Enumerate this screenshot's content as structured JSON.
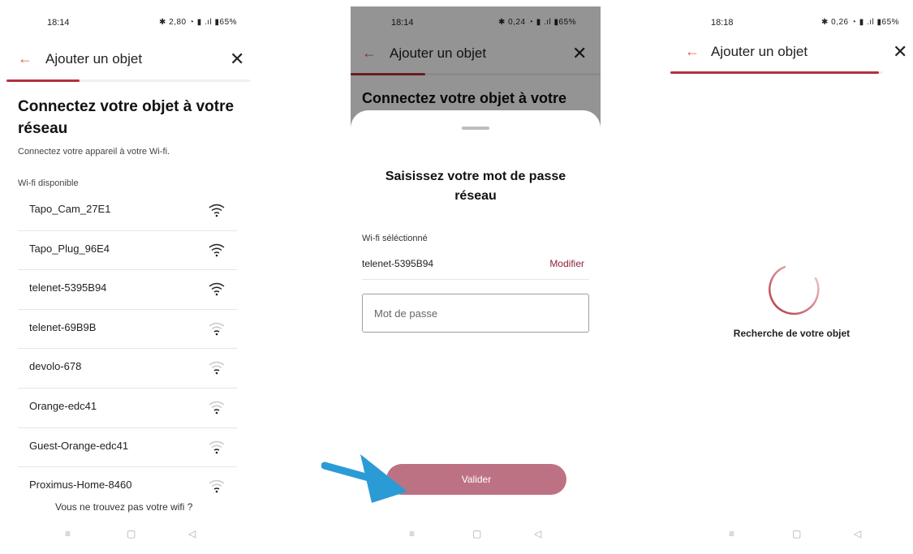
{
  "screen1": {
    "status_time": "18:14",
    "status_indicators": "✱ 2,80 ◔ ▮ .ıl ▮65%",
    "back_icon": "back-arrow-icon",
    "title": "Ajouter un objet",
    "close_icon": "close-icon",
    "progress": 0.3,
    "heading": "Connectez votre objet à votre réseau",
    "subtitle": "Connectez votre appareil à votre Wi-fi.",
    "list_label": "Wi-fi disponible",
    "networks": [
      {
        "name": "Tapo_Cam_27E1",
        "signal": "strong"
      },
      {
        "name": "Tapo_Plug_96E4",
        "signal": "strong"
      },
      {
        "name": "telenet-5395B94",
        "signal": "strong"
      },
      {
        "name": "telenet-69B9B",
        "signal": "weak"
      },
      {
        "name": "devolo-678",
        "signal": "weak"
      },
      {
        "name": "Orange-edc41",
        "signal": "weak"
      },
      {
        "name": "Guest-Orange-edc41",
        "signal": "weak"
      },
      {
        "name": "Proximus-Home-8460",
        "signal": "weak"
      }
    ],
    "not_found_link": "Vous ne trouvez pas votre wifi ?"
  },
  "screen2": {
    "status_time": "18:14",
    "status_indicators": "✱ 0,24 ◔ ▮ .ıl ▮65%",
    "title": "Ajouter un objet",
    "progress": 0.3,
    "heading_partial": "Connectez votre objet à votre",
    "sheet_title": "Saisissez votre mot de passe réseau",
    "selected_label": "Wi-fi séléctionné",
    "selected_network": "telenet-5395B94",
    "modify_label": "Modifier",
    "password_placeholder": "Mot de passe",
    "validate_label": "Valider"
  },
  "screen3": {
    "status_time": "18:18",
    "status_indicators": "✱ 0,26 ◔ ▮ .ıl ▮65%",
    "title": "Ajouter un objet",
    "progress": 0.98,
    "loading_text": "Recherche de votre objet"
  },
  "nav": {
    "menu_icon": "≡",
    "home_icon": "▢",
    "back_icon": "◁"
  },
  "colors": {
    "accent": "#b1323d",
    "button": "#bd7283",
    "link": "#8c2338",
    "annotation_arrow": "#2b9bd6"
  }
}
